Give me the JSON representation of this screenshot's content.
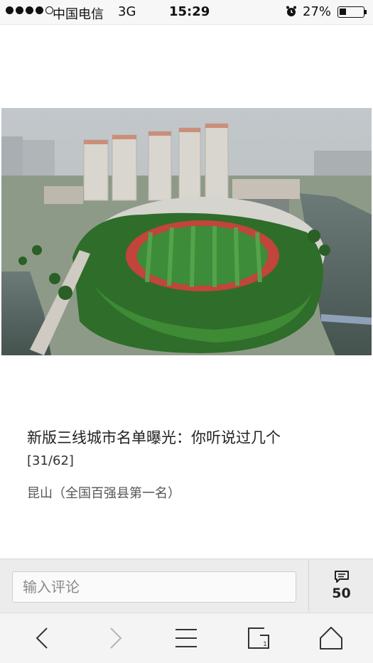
{
  "status_bar": {
    "carrier": "中国电信",
    "network": "3G",
    "time": "15:29",
    "battery": "27%",
    "signal_bars_filled": 4,
    "signal_bars_total": 5
  },
  "photo": {
    "subject": "aerial-city-stadium"
  },
  "caption": {
    "title": "新版三线城市名单曝光：你听说过几个",
    "index": "[31/62]",
    "description": "昆山（全国百强县第一名）"
  },
  "comment_bar": {
    "placeholder": "输入评论",
    "count": "50"
  },
  "nav": {
    "items": [
      "back-icon",
      "forward-icon",
      "menu-icon",
      "tabs-icon",
      "home-icon"
    ]
  },
  "colors": {
    "status_bg": "#f7f7f7",
    "comment_bar_bg": "#ececec",
    "nav_bg": "#f4f4f4",
    "icon_active": "#333333",
    "icon_disabled": "#b5b5b5"
  }
}
